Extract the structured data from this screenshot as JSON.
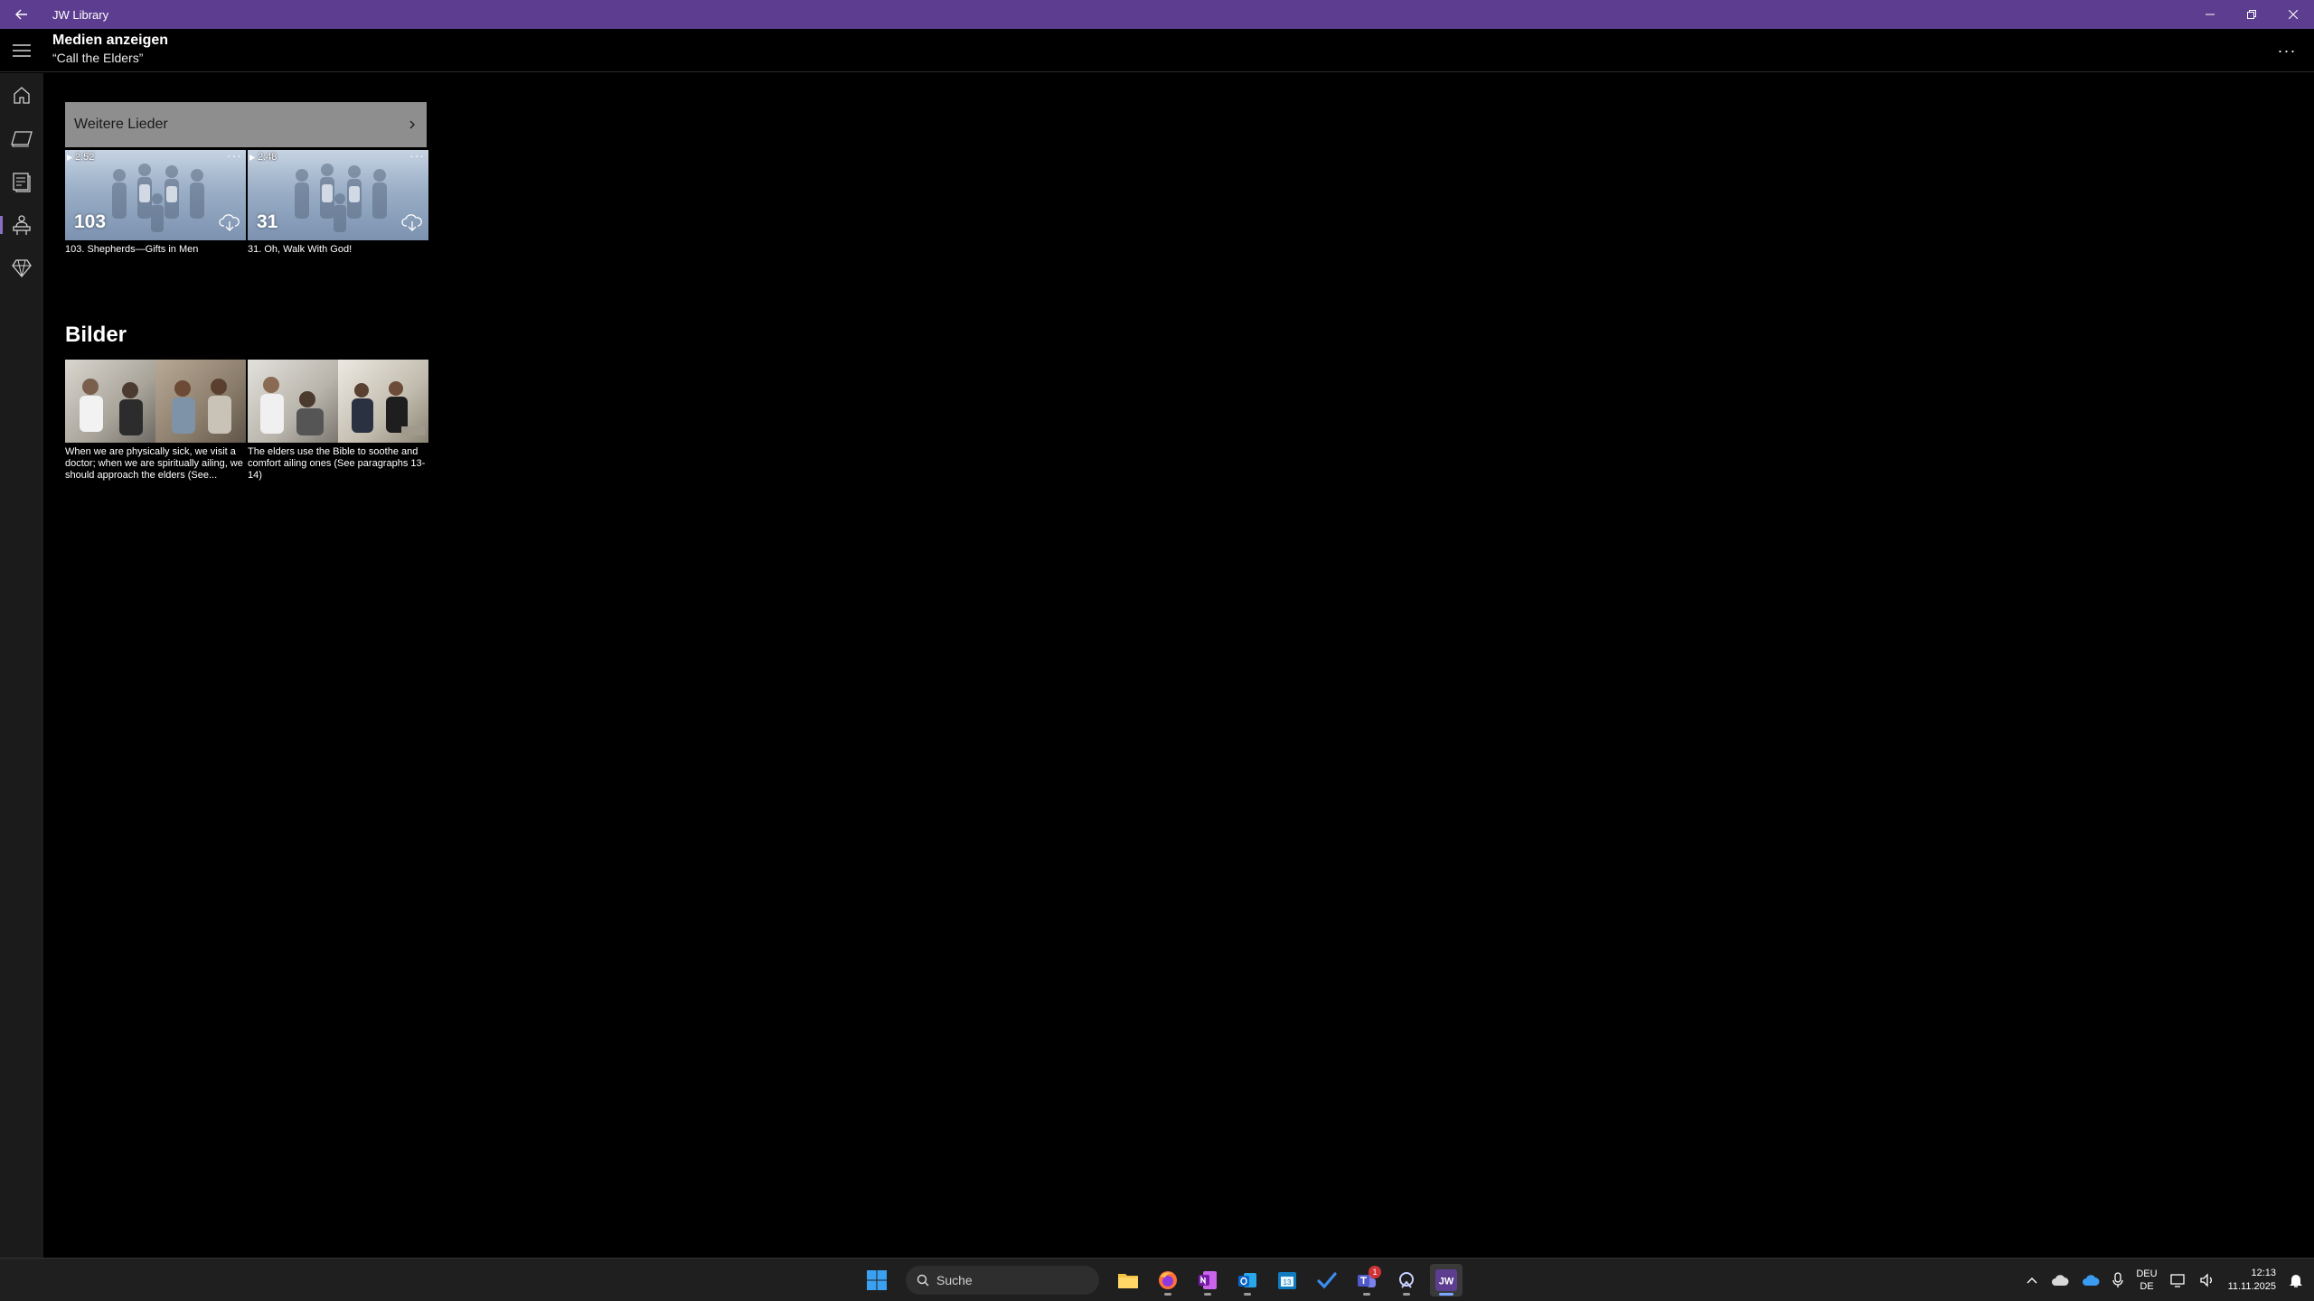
{
  "window": {
    "title": "JW Library"
  },
  "header": {
    "title": "Medien anzeigen",
    "subtitle": "“Call the Elders”",
    "more_label": "···"
  },
  "nav": {
    "items": [
      {
        "icon": "home-icon"
      },
      {
        "icon": "bible-icon"
      },
      {
        "icon": "publications-icon"
      },
      {
        "icon": "meetings-icon",
        "active": true
      },
      {
        "icon": "personal-study-icon"
      }
    ]
  },
  "songs": {
    "more_button": "Weitere Lieder",
    "items": [
      {
        "number": "103",
        "duration": "2:52",
        "caption": "103. Shepherds—Gifts in Men"
      },
      {
        "number": "31",
        "duration": "2:48",
        "caption": "31. Oh, Walk With God!"
      }
    ]
  },
  "images": {
    "section_title": "Bilder",
    "items": [
      {
        "caption": "When we are physically sick, we visit a doctor; when we are spiritually ailing, we should approach the elders (See..."
      },
      {
        "caption": "The elders use the Bible to soothe and comfort ailing ones (See paragraphs 13-14)"
      }
    ]
  },
  "taskbar": {
    "search_placeholder": "Suche",
    "teams_badge": "1",
    "language_top": "DEU",
    "language_bottom": "DE",
    "time": "12:13",
    "date": "11.11.2025",
    "apps": [
      "start-icon",
      "file-explorer-icon",
      "firefox-icon",
      "onenote-icon",
      "outlook-icon",
      "calendar-icon",
      "todo-icon",
      "teams-icon",
      "notepad-icon",
      "jw-library-icon"
    ]
  },
  "colors": {
    "titlebar": "#5c3d8f",
    "accent": "#8a6fc4",
    "more_button_bg": "#8e8e8e"
  }
}
